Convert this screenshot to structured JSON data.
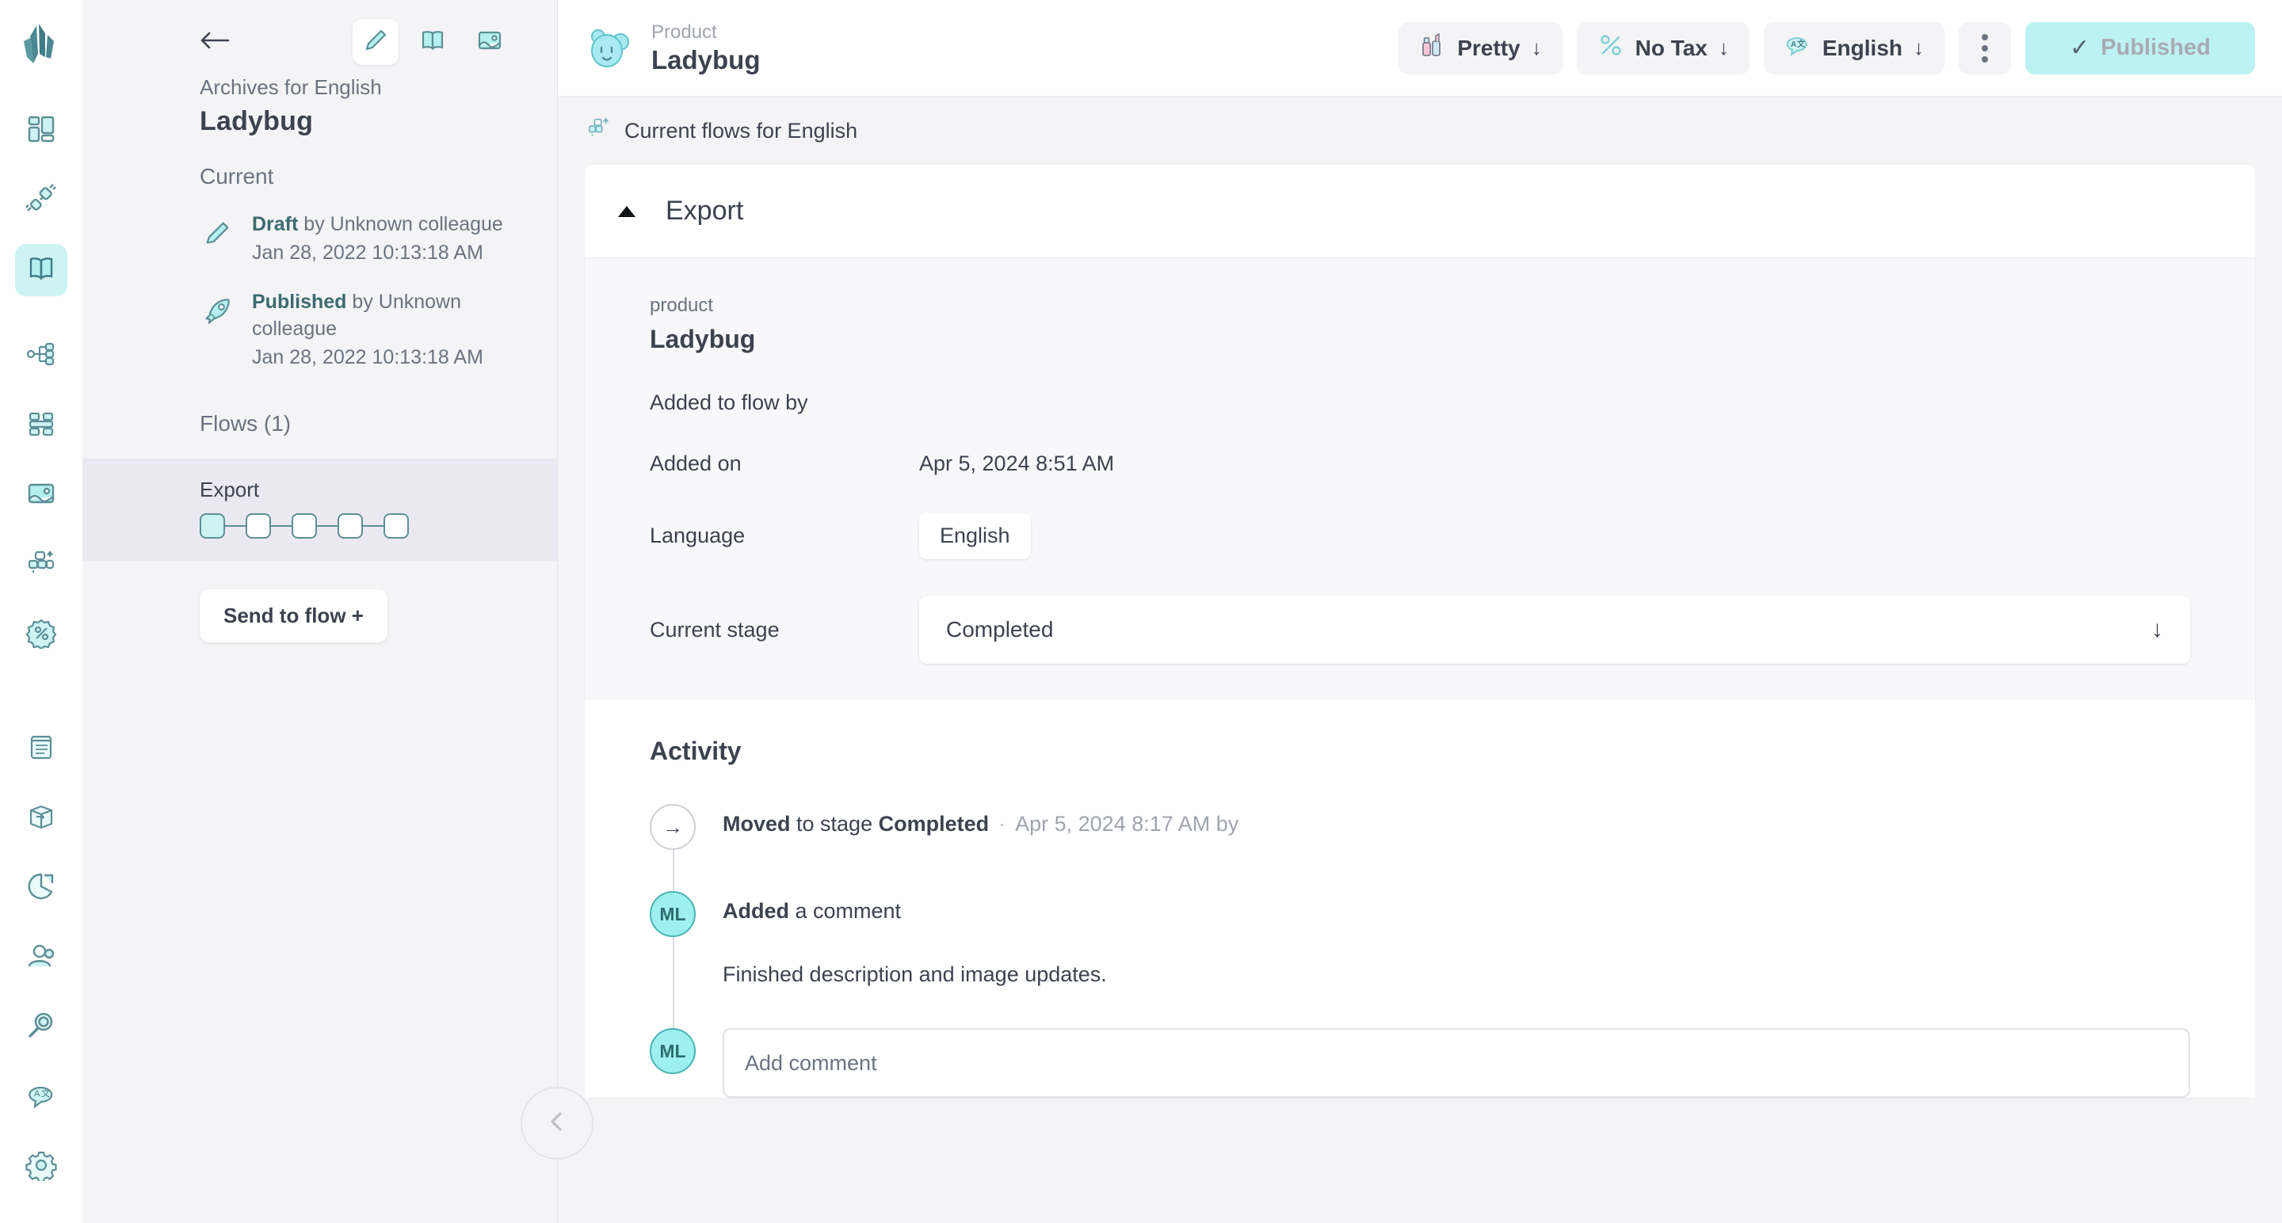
{
  "rail": {
    "logo_icon": "crystal-logo",
    "items": [
      {
        "icon": "dashboard-icon",
        "name": "dashboard",
        "active": false
      },
      {
        "icon": "plug-integrations-icon",
        "name": "integrations",
        "active": false
      },
      {
        "icon": "book-catalog-icon",
        "name": "catalog",
        "active": true
      },
      {
        "icon": "hierarchy-icon",
        "name": "hierarchy",
        "active": false
      },
      {
        "icon": "grid-layout-icon",
        "name": "layouts",
        "active": false
      },
      {
        "icon": "image-media-icon",
        "name": "media",
        "active": false
      },
      {
        "icon": "flows-icon",
        "name": "flows",
        "active": false
      },
      {
        "icon": "discount-badge-icon",
        "name": "discounts",
        "active": false
      },
      {
        "icon": "clipboard-icon",
        "name": "reports",
        "active": false
      },
      {
        "icon": "box-export-icon",
        "name": "export",
        "active": false
      },
      {
        "icon": "pie-chart-icon",
        "name": "analytics",
        "active": false
      },
      {
        "icon": "user-icon",
        "name": "users",
        "active": false
      },
      {
        "icon": "search-icon",
        "name": "search",
        "active": false
      },
      {
        "icon": "translate-icon",
        "name": "translations",
        "active": false
      },
      {
        "icon": "gear-icon",
        "name": "settings",
        "active": false
      }
    ]
  },
  "left_panel": {
    "back_icon": "arrow-left-icon",
    "top_icons": [
      {
        "icon": "pencil-icon",
        "name": "edit",
        "boxed": true
      },
      {
        "icon": "book-icon",
        "name": "preview",
        "boxed": false
      },
      {
        "icon": "image-icon",
        "name": "media",
        "boxed": false
      }
    ],
    "subtitle": "Archives for English",
    "title": "Ladybug",
    "current_label": "Current",
    "revisions": [
      {
        "icon": "pencil-icon",
        "status": "Draft",
        "by": " by Unknown colleague",
        "timestamp": "Jan 28, 2022 10:13:18 AM"
      },
      {
        "icon": "rocket-icon",
        "status": "Published",
        "by": " by Unknown colleague",
        "timestamp": "Jan 28, 2022 10:13:18 AM"
      }
    ],
    "flows_label": "Flows (1)",
    "flows": [
      {
        "name": "Export",
        "steps": 5,
        "completed_steps": 1
      }
    ],
    "send_to_flow_label": "Send to flow +",
    "collapse_icon": "chevron-left-icon"
  },
  "topbar": {
    "avatar_icon": "ladybug-avatar-icon",
    "kicker": "Product",
    "name": "Ladybug",
    "buttons": [
      {
        "icon": "cosmetics-icon",
        "label": "Pretty",
        "caret": "↓"
      },
      {
        "icon": "percent-icon",
        "label": "No Tax",
        "caret": "↓"
      },
      {
        "icon": "translate-icon",
        "label": "English",
        "caret": "↓"
      }
    ],
    "kebab_name": "more-options",
    "publish": {
      "check": "✓",
      "label": "Published"
    }
  },
  "breadcrumb": {
    "icon": "flows-icon",
    "text": "Current flows for English"
  },
  "export_card": {
    "collapse_icon": "triangle-up-icon",
    "title": "Export",
    "product_kicker": "product",
    "product_name": "Ladybug",
    "fields": [
      {
        "label": "Added to flow by",
        "value": "",
        "type": "text"
      },
      {
        "label": "Added on",
        "value": "Apr 5, 2024 8:51 AM",
        "type": "text"
      },
      {
        "label": "Language",
        "value": "English",
        "type": "chip"
      },
      {
        "label": "Current stage",
        "value": "Completed",
        "type": "select",
        "arrow": "↓"
      }
    ]
  },
  "activity": {
    "title": "Activity",
    "entries": [
      {
        "kind": "stage-change",
        "dot_icon": "arrow-right-icon",
        "dot_text": "→",
        "bold1": "Moved",
        "mid": " to stage ",
        "bold2": "Completed",
        "separator": "·",
        "meta": "Apr 5, 2024 8:17 AM by"
      },
      {
        "kind": "comment",
        "avatar_initials": "ML",
        "bold1": "Added",
        "mid": " a comment",
        "body": "Finished description and image updates."
      }
    ],
    "composer": {
      "avatar_initials": "ML",
      "placeholder": "Add comment"
    }
  },
  "colors": {
    "accent": "#9ef0ef",
    "accent_soft": "#cdf3f3",
    "icon_stroke": "#5d8f97",
    "text": "#3d4250",
    "muted": "#6b7280",
    "panel_bg": "#f4f4f6",
    "flow_selected_bg": "#eae9f1"
  }
}
